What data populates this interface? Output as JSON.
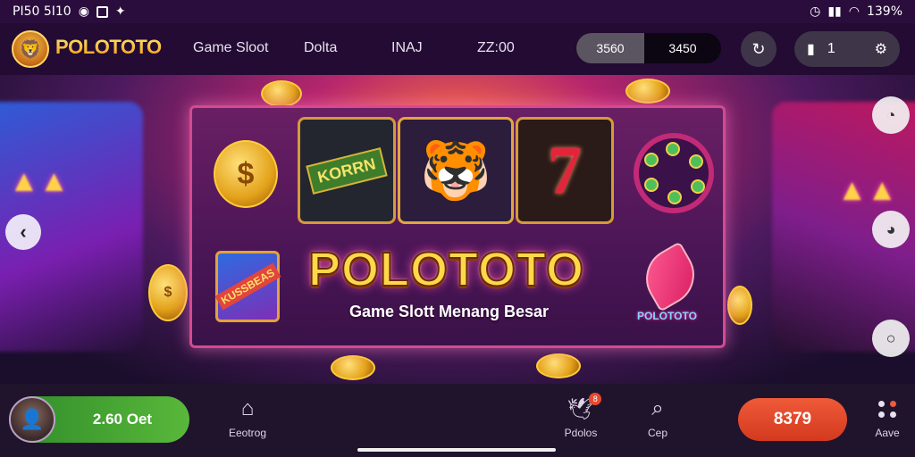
{
  "status_bar": {
    "left_text": "PI50 5I10",
    "right_text": "139%"
  },
  "header": {
    "logo_text": "POLOTOTO",
    "nav": [
      "Game Sloot",
      "Dolta",
      "INAJ",
      "ZZ:00"
    ],
    "balance_left": "3560",
    "balance_right": "3450",
    "notification_count": "1"
  },
  "banner": {
    "reel_label": "KORRN",
    "brand_title": "POLOTOTO",
    "tagline": "Game Slott Menang Besar",
    "shield_label": "KUSSBEAS",
    "small_logo": "POLOTOTO",
    "seven": "7"
  },
  "bottom_bar": {
    "user_amount": "2.60 Oet",
    "tabs": [
      {
        "label": "Eeotrog",
        "icon": "home-icon"
      },
      {
        "label": "Pdolos",
        "icon": "bird-icon",
        "badge": "8"
      },
      {
        "label": "Cep",
        "icon": "search-icon"
      },
      {
        "label": "Aave",
        "icon": "more-dots-icon"
      }
    ],
    "cta_label": "8379"
  }
}
